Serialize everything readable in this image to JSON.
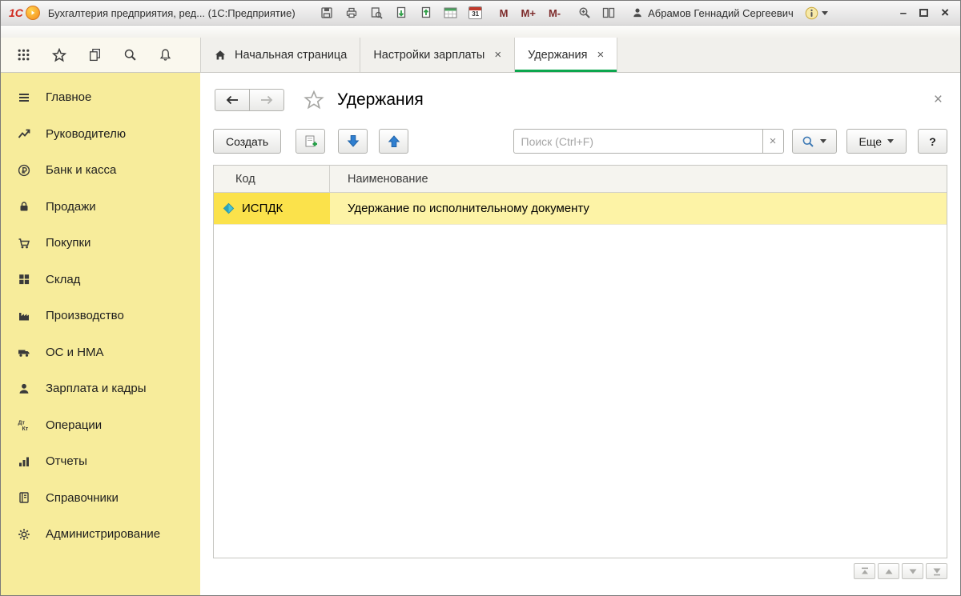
{
  "titlebar": {
    "logo": "1С",
    "title": "Бухгалтерия предприятия, ред... (1С:Предприятие)",
    "memory": {
      "m": "М",
      "m_plus": "М+",
      "m_minus": "М-"
    },
    "calendar_day": "31",
    "user": "Абрамов Геннадий Сергеевич"
  },
  "icons": {
    "close": "×",
    "minimize": "–"
  },
  "tabs": {
    "home": "Начальная страница",
    "salary_settings": "Настройки зарплаты",
    "deductions": "Удержания"
  },
  "sidebar": {
    "items": [
      {
        "label": "Главное"
      },
      {
        "label": "Руководителю"
      },
      {
        "label": "Банк и касса"
      },
      {
        "label": "Продажи"
      },
      {
        "label": "Покупки"
      },
      {
        "label": "Склад"
      },
      {
        "label": "Производство"
      },
      {
        "label": "ОС и НМА"
      },
      {
        "label": "Зарплата и кадры"
      },
      {
        "label": "Операции"
      },
      {
        "label": "Отчеты"
      },
      {
        "label": "Справочники"
      },
      {
        "label": "Администрирование"
      }
    ]
  },
  "page": {
    "title": "Удержания",
    "toolbar": {
      "create": "Создать",
      "search_placeholder": "Поиск (Ctrl+F)",
      "more": "Еще",
      "help": "?"
    }
  },
  "table": {
    "columns": {
      "code": "Код",
      "name": "Наименование"
    },
    "rows": [
      {
        "code": "ИСПДК",
        "name": "Удержание по исполнительному документу"
      }
    ]
  },
  "colors": {
    "accent_green": "#0ca64e",
    "sidebar_yellow": "#f7ec9b",
    "selection_code_yellow": "#fbe24b",
    "selection_name_yellow": "#fdf3a6",
    "arrow_blue": "#2f7fd0"
  }
}
